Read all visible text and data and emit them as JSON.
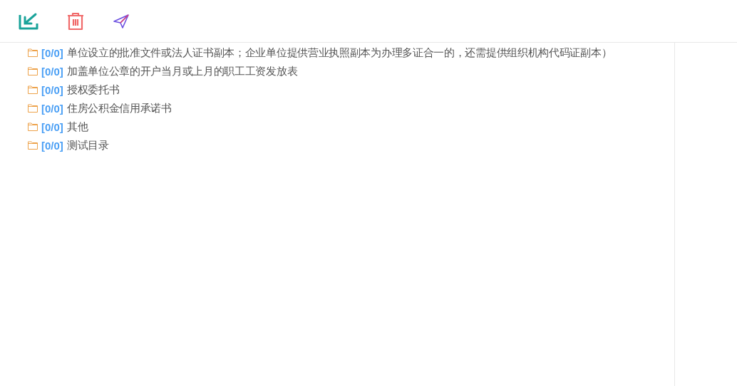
{
  "toolbar": {
    "buttons": [
      {
        "kind": "import"
      },
      {
        "kind": "delete"
      },
      {
        "kind": "send"
      }
    ]
  },
  "folders": [
    {
      "count": "[0/0]",
      "name": "单位设立的批准文件或法人证书副本；企业单位提供营业执照副本为办理多证合一的，还需提供组织机构代码证副本）"
    },
    {
      "count": "[0/0]",
      "name": "加盖单位公章的开户当月或上月的职工工资发放表"
    },
    {
      "count": "[0/0]",
      "name": "授权委托书"
    },
    {
      "count": "[0/0]",
      "name": "住房公积金信用承诺书"
    },
    {
      "count": "[0/0]",
      "name": "其他"
    },
    {
      "count": "[0/0]",
      "name": "测试目录"
    }
  ]
}
